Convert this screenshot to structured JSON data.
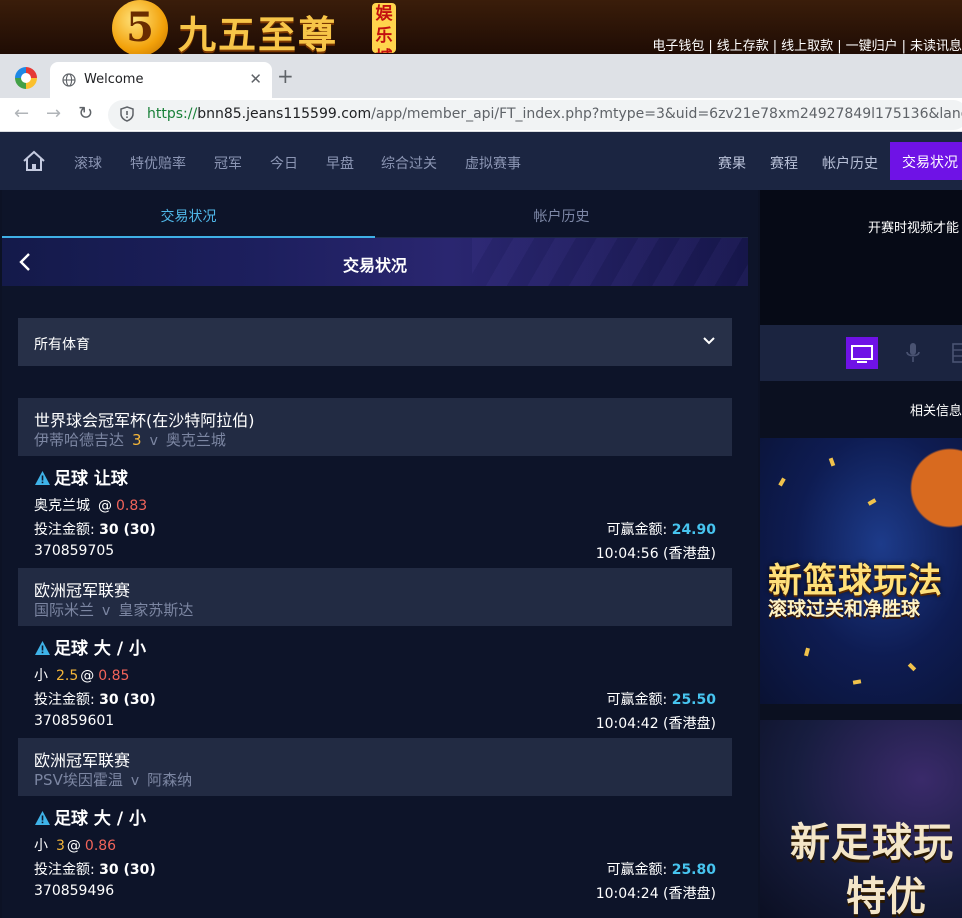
{
  "banner": {
    "logo_digit": "5",
    "logo_text": "九五至尊",
    "logo_tag": "娱乐城",
    "links": [
      "电子钱包",
      "线上存款",
      "线上取款",
      "一键归户",
      "未读讯息"
    ]
  },
  "browser": {
    "tab_title": "Welcome",
    "url_scheme": "https://",
    "url_host": "bnn85.jeans115599.com",
    "url_path": "/app/member_api/FT_index.php?mtype=3&uid=6zv21e78xm24927849l175136&langx=zh"
  },
  "app_nav": {
    "left_items": [
      "滚球",
      "特优赔率",
      "冠军",
      "今日",
      "早盘",
      "综合过关",
      "虚拟赛事"
    ],
    "right_items": [
      "赛果",
      "赛程",
      "帐户历史"
    ],
    "active_item": "交易状况"
  },
  "main": {
    "tabs": [
      "交易状况",
      "帐户历史"
    ],
    "page_title": "交易状况",
    "sport_filter": "所有体育",
    "bets": [
      {
        "league": "世界球会冠军杯(在沙特阿拉伯)",
        "home": "伊蒂哈德吉达",
        "handicap": "3",
        "vs": "v",
        "away": "奥克兰城",
        "bet_type": "足球 让球",
        "selection": "奥克兰城",
        "line": "",
        "at": "@",
        "odds": "0.83",
        "stake_label": "投注金额:",
        "stake": "30 (30)",
        "win_label": "可赢金额:",
        "win": "24.90",
        "ticket": "370859705",
        "time": "10:04:56 (香港盘)"
      },
      {
        "league": "欧洲冠军联赛",
        "home": "国际米兰",
        "handicap": "",
        "vs": "v",
        "away": "皇家苏斯达",
        "bet_type": "足球 大 / 小",
        "selection": "小",
        "line": "2.5",
        "at": "@",
        "odds": "0.85",
        "stake_label": "投注金额:",
        "stake": "30 (30)",
        "win_label": "可赢金额:",
        "win": "25.50",
        "ticket": "370859601",
        "time": "10:04:42 (香港盘)"
      },
      {
        "league": "欧洲冠军联赛",
        "home": "PSV埃因霍温",
        "handicap": "",
        "vs": "v",
        "away": "阿森纳",
        "bet_type": "足球 大 / 小",
        "selection": "小",
        "line": "3",
        "at": "@",
        "odds": "0.86",
        "stake_label": "投注金额:",
        "stake": "30 (30)",
        "win_label": "可赢金额:",
        "win": "25.80",
        "ticket": "370859496",
        "time": "10:04:24 (香港盘)"
      }
    ]
  },
  "side": {
    "video_message": "开赛时视频才能",
    "info_label": "相关信息",
    "promo1_title": "新篮球玩法",
    "promo1_sub": "滚球过关和净胜球",
    "promo2_title": "新足球玩",
    "promo2_sub": "特优"
  },
  "colors": {
    "accent_purple": "#6f12e6",
    "tab_active_blue": "#4fb7e8",
    "win_amount": "#47c4ef",
    "odds_red": "#f2645a",
    "line_orange": "#f4b63a"
  }
}
